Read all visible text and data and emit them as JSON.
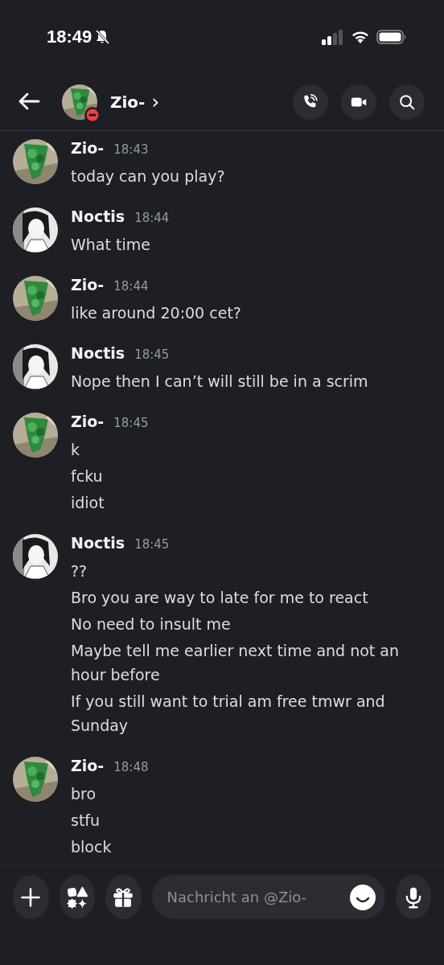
{
  "status_bar": {
    "time": "18:49",
    "muted": true
  },
  "header": {
    "name": "Zio-",
    "chevron": "›",
    "do_not_disturb": true
  },
  "messages": [
    {
      "author": "Zio-",
      "time": "18:43",
      "lines": [
        "today can you play?"
      ]
    },
    {
      "author": "Noctis",
      "time": "18:44",
      "lines": [
        "What time"
      ]
    },
    {
      "author": "Zio-",
      "time": "18:44",
      "lines": [
        "like around 20:00 cet?"
      ]
    },
    {
      "author": "Noctis",
      "time": "18:45",
      "lines": [
        "Nope then I can’t will still be in a scrim"
      ]
    },
    {
      "author": "Zio-",
      "time": "18:45",
      "lines": [
        "k",
        "fcku",
        "idiot"
      ]
    },
    {
      "author": "Noctis",
      "time": "18:45",
      "lines": [
        "??",
        "Bro you are way to late for me to react",
        "No need to insult me",
        "Maybe tell me earlier next time and not an hour before",
        "If you still want to trial am free tmwr and Sunday"
      ]
    },
    {
      "author": "Zio-",
      "time": "18:48",
      "lines": [
        "bro",
        "stfu",
        "block"
      ]
    }
  ],
  "composer": {
    "placeholder": "Nachricht an @Zio-"
  }
}
